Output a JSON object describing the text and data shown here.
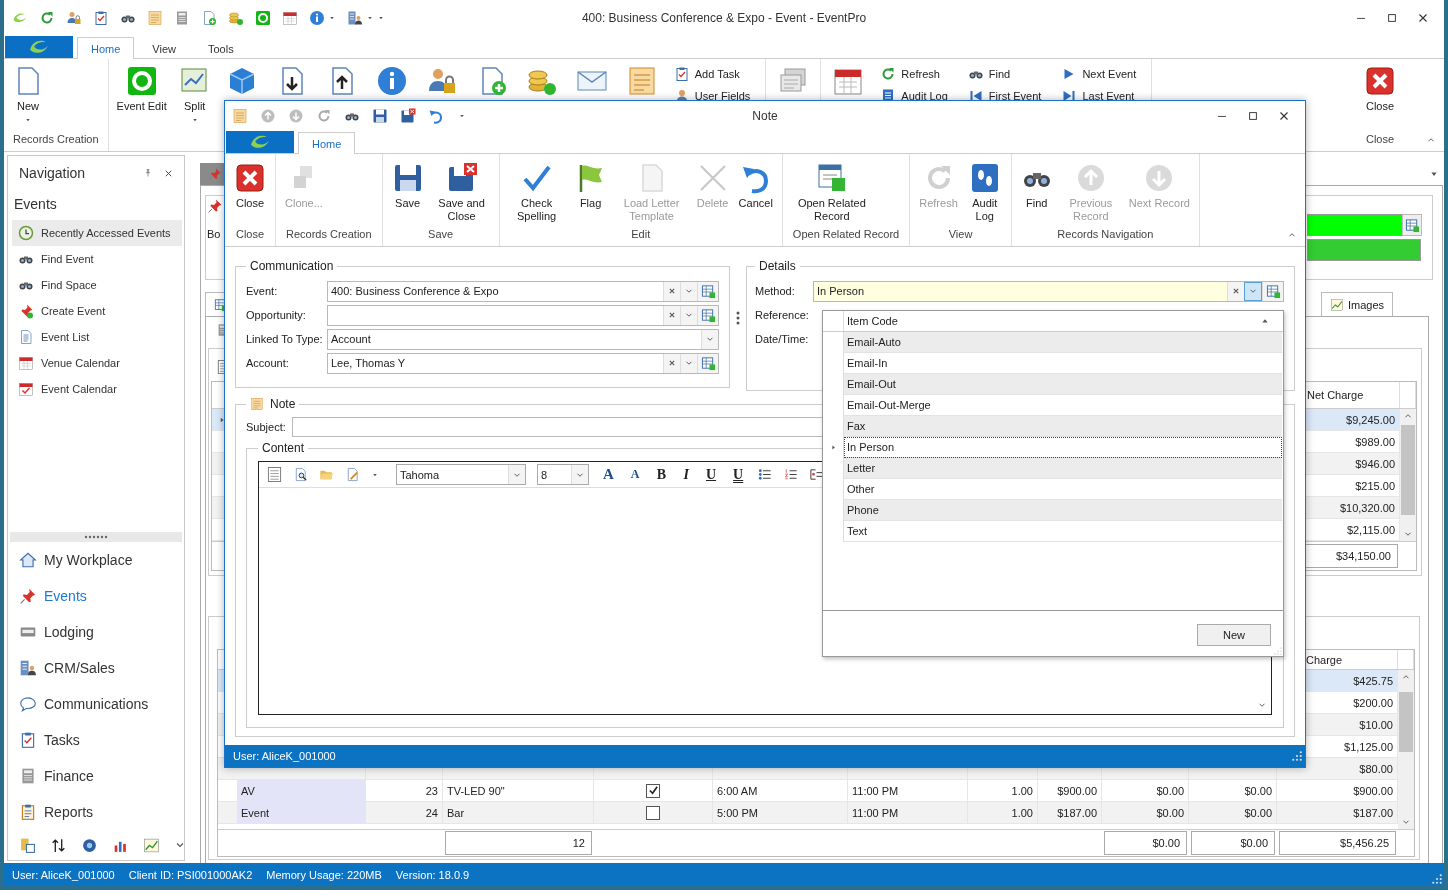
{
  "window": {
    "title": "400: Business Conference & Expo - Event - EventPro"
  },
  "ribbon_tabs": [
    {
      "label": "Home",
      "selected": true
    },
    {
      "label": "View",
      "selected": false
    },
    {
      "label": "Tools",
      "selected": false
    }
  ],
  "ribbon": {
    "groups": [
      {
        "label": "Records Creation",
        "buttons": [
          {
            "label": "New",
            "kind": "big",
            "dropdown": true
          }
        ]
      },
      {
        "buttons": [
          {
            "label": "Event Edit",
            "kind": "big",
            "dropdown": false
          },
          {
            "label": "Split",
            "kind": "big",
            "dropdown": true
          },
          {
            "kind": "big"
          },
          {
            "kind": "big"
          },
          {
            "kind": "big"
          },
          {
            "kind": "big"
          },
          {
            "kind": "big"
          },
          {
            "kind": "big"
          },
          {
            "kind": "big"
          },
          {
            "kind": "big"
          },
          {
            "kind": "big"
          },
          {
            "label": "Add Task",
            "kind": "small"
          },
          {
            "label": "User Fields",
            "kind": "small"
          }
        ]
      },
      {
        "buttons": [
          {
            "kind": "big"
          }
        ]
      },
      {
        "buttons": [
          {
            "kind": "big"
          },
          {
            "label": "Refresh",
            "kind": "small"
          },
          {
            "label": "Audit Log",
            "kind": "small"
          },
          {
            "label": "Find",
            "kind": "small"
          },
          {
            "label": "First Event",
            "kind": "small"
          },
          {
            "label": "Next Event",
            "kind": "small"
          },
          {
            "label": "Last Event",
            "kind": "small"
          }
        ]
      },
      {
        "label": "Close",
        "buttons": [
          {
            "label": "Close",
            "kind": "big",
            "dropdown": false
          }
        ]
      }
    ]
  },
  "navigation": {
    "title": "Navigation",
    "section": "Events",
    "items": [
      {
        "label": "Recently Accessed Events",
        "selected": true
      },
      {
        "label": "Find Event",
        "selected": false
      },
      {
        "label": "Find Space",
        "selected": false
      },
      {
        "label": "Create Event",
        "selected": false
      },
      {
        "label": "Event List",
        "selected": false
      },
      {
        "label": "Venue Calendar",
        "selected": false
      },
      {
        "label": "Event Calendar",
        "selected": false
      }
    ],
    "modules": [
      {
        "label": "My Workplace",
        "selected": false
      },
      {
        "label": "Events",
        "selected": true
      },
      {
        "label": "Lodging",
        "selected": false
      },
      {
        "label": "CRM/Sales",
        "selected": false
      },
      {
        "label": "Communications",
        "selected": false
      },
      {
        "label": "Tasks",
        "selected": false
      },
      {
        "label": "Finance",
        "selected": false
      },
      {
        "label": "Reports",
        "selected": false
      }
    ]
  },
  "document": {
    "group_label": "Bo",
    "color_fields": [
      {
        "color": "#00ff00"
      },
      {
        "color": "#33cc33"
      }
    ],
    "tabs": [
      {
        "label": "Images"
      }
    ]
  },
  "grid_1": {
    "header": "Net Charge",
    "rows": [
      {
        "net_charge": "$9,245.00",
        "selected": true
      },
      {
        "net_charge": "$989.00",
        "selected": false
      },
      {
        "net_charge": "$946.00",
        "selected": false
      },
      {
        "net_charge": "$215.00",
        "selected": false
      },
      {
        "net_charge": "$10,320.00",
        "selected": false
      },
      {
        "net_charge": "$2,115.00",
        "selected": false
      }
    ],
    "total": "$34,150.00"
  },
  "grid_2": {
    "header": "Charge",
    "rows": [
      {
        "charge": "$425.75",
        "selected": true
      },
      {
        "charge": "$200.00",
        "selected": false
      },
      {
        "charge": "$10.00",
        "selected": false
      },
      {
        "charge": "$1,125.00",
        "selected": false
      },
      {
        "charge": "$80.00",
        "selected": false
      },
      {
        "column_1": "AV",
        "column_2": "23",
        "column_3": "TV-LED 90\"",
        "checked": true,
        "column_5": "6:00 AM",
        "column_6": "11:00 PM",
        "column_7": "1.00",
        "column_8": "$900.00",
        "column_9": "$0.00",
        "column_10": "$0.00",
        "charge": "$900.00",
        "selected": false
      },
      {
        "column_1": "Event",
        "column_2": "24",
        "column_3": "Bar",
        "checked": false,
        "column_5": "5:00 PM",
        "column_6": "11:00 PM",
        "column_7": "1.00",
        "column_8": "$187.00",
        "column_9": "$0.00",
        "column_10": "$0.00",
        "charge": "$187.00",
        "selected": false
      }
    ],
    "footer": {
      "count": "12",
      "column_9": "$0.00",
      "column_10": "$0.00",
      "charge": "$5,456.25"
    }
  },
  "status_bar": [
    "User: AliceK_001000",
    "Client ID: PSI001000AK2",
    "Memory Usage: 220MB",
    "Version: 18.0.9"
  ],
  "dialog": {
    "title": "Note",
    "tabs": [
      {
        "label": "Home",
        "selected": true
      }
    ],
    "groups": [
      {
        "label": "Close",
        "buttons": [
          {
            "label": "Close",
            "disabled": false
          }
        ]
      },
      {
        "label": "Records Creation",
        "buttons": [
          {
            "label": "Clone...",
            "disabled": true
          }
        ]
      },
      {
        "label": "Save",
        "buttons": [
          {
            "label": "Save",
            "disabled": false
          },
          {
            "label": "Save and Close",
            "disabled": false
          }
        ]
      },
      {
        "label": "Edit",
        "buttons": [
          {
            "label": "Check Spelling",
            "disabled": false
          },
          {
            "label": "Flag",
            "disabled": false
          },
          {
            "label": "Load Letter Template",
            "disabled": true
          },
          {
            "label": "Delete",
            "disabled": true
          },
          {
            "label": "Cancel",
            "disabled": false
          }
        ]
      },
      {
        "label": "Open Related Record",
        "buttons": [
          {
            "label": "Open Related Record",
            "disabled": false
          }
        ]
      },
      {
        "label": "View",
        "buttons": [
          {
            "label": "Refresh",
            "disabled": true
          },
          {
            "label": "Audit Log",
            "disabled": false
          }
        ]
      },
      {
        "label": "Records Navigation",
        "buttons": [
          {
            "label": "Find",
            "disabled": false
          },
          {
            "label": "Previous Record",
            "disabled": true
          },
          {
            "label": "Next Record",
            "disabled": true
          }
        ]
      }
    ],
    "communication": {
      "title": "Communication",
      "fields": [
        {
          "label": "Event:",
          "value": "400: Business Conference & Expo",
          "kind": "lookup",
          "focused": false
        },
        {
          "label": "Opportunity:",
          "kind": "lookup",
          "focused": false
        },
        {
          "label": "Linked To Type:",
          "value": "Account",
          "kind": "combo",
          "focused": false
        },
        {
          "label": "Account:",
          "value": "Lee, Thomas Y",
          "kind": "lookup",
          "focused": false
        }
      ]
    },
    "details": {
      "title": "Details",
      "fields": [
        {
          "label": "Method:",
          "value": "In Person",
          "kind": "lookup",
          "focused": true
        },
        {
          "label": "Reference:"
        },
        {
          "label": "Date/Time:"
        }
      ]
    },
    "note": {
      "title": "Note",
      "subject_label": "Subject:",
      "content_title": "Content",
      "font": "Tahoma",
      "size": "8",
      "format_buttons": [
        "A",
        "A",
        "B",
        "I",
        "U",
        "U"
      ]
    },
    "status": "User: AliceK_001000"
  },
  "popup": {
    "column": "Item Code",
    "items": [
      {
        "label": "Email-Auto",
        "selected": false
      },
      {
        "label": "Email-In",
        "selected": false
      },
      {
        "label": "Email-Out",
        "selected": false
      },
      {
        "label": "Email-Out-Merge",
        "selected": false
      },
      {
        "label": "Fax",
        "selected": false
      },
      {
        "label": "In Person",
        "selected": true
      },
      {
        "label": "Letter",
        "selected": false
      },
      {
        "label": "Other",
        "selected": false
      },
      {
        "label": "Phone",
        "selected": false
      },
      {
        "label": "Text",
        "selected": false
      }
    ],
    "button": "New"
  }
}
